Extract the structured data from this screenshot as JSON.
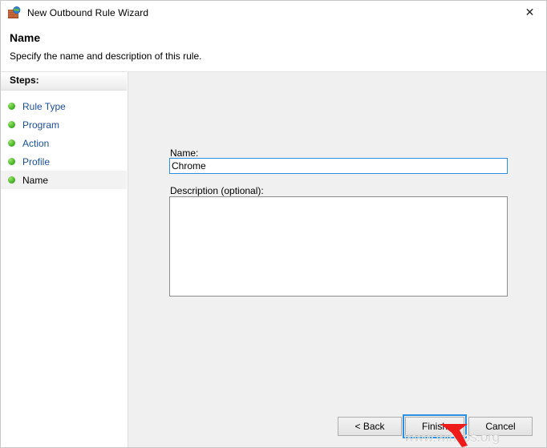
{
  "window": {
    "title": "New Outbound Rule Wizard",
    "icon": "firewall-globe-icon",
    "close_label": "✕"
  },
  "header": {
    "title": "Name",
    "subtitle": "Specify the name and description of this rule."
  },
  "sidebar": {
    "heading": "Steps:",
    "items": [
      {
        "label": "Rule Type",
        "current": false
      },
      {
        "label": "Program",
        "current": false
      },
      {
        "label": "Action",
        "current": false
      },
      {
        "label": "Profile",
        "current": false
      },
      {
        "label": "Name",
        "current": true
      }
    ]
  },
  "form": {
    "name_label": "Name:",
    "name_value": "Chrome",
    "name_placeholder": "",
    "description_label": "Description (optional):",
    "description_value": "",
    "description_placeholder": ""
  },
  "buttons": {
    "back": "< Back",
    "finish": "Finish",
    "cancel": "Cancel"
  },
  "annotations": {
    "watermark": "www.wintips.org",
    "cursor_arrow": "red-arrow-pointer"
  },
  "colors": {
    "focus_blue": "#2a8fe0",
    "link_blue": "#1a4f9c",
    "panel_gray": "#f0f0f0",
    "step_bullet_green": "#4cba2c",
    "annotation_red": "#ee1b1b",
    "watermark_gray": "#d6d6d6"
  }
}
